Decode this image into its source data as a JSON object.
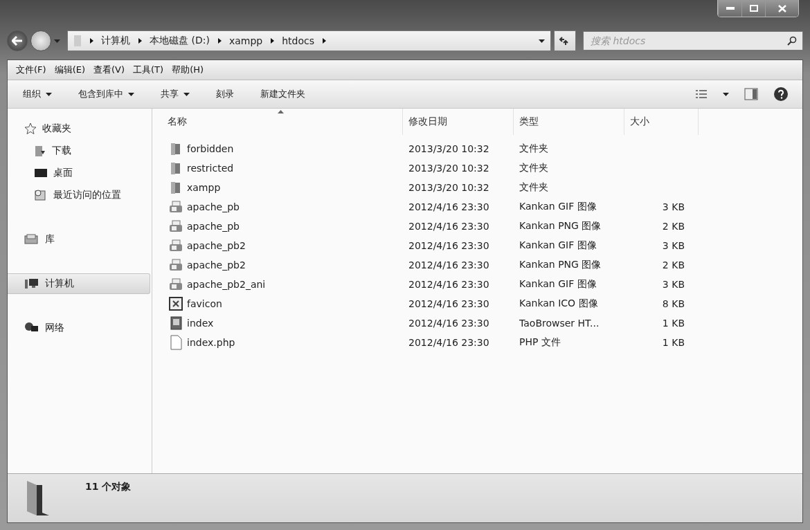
{
  "window_controls": [
    {
      "kind": "minimize"
    },
    {
      "kind": "maximize"
    },
    {
      "kind": "close"
    }
  ],
  "address_bar": {
    "segments": [
      "计算机",
      "本地磁盘 (D:)",
      "xampp",
      "htdocs"
    ]
  },
  "search": {
    "placeholder": "搜索 htdocs"
  },
  "menu_bar": [
    "文件(F)",
    "编辑(E)",
    "查看(V)",
    "工具(T)",
    "帮助(H)"
  ],
  "command_bar": [
    {
      "label": "组织",
      "has_menu": true
    },
    {
      "label": "包含到库中",
      "has_menu": true
    },
    {
      "label": "共享",
      "has_menu": true
    },
    {
      "label": "刻录",
      "has_menu": false
    },
    {
      "label": "新建文件夹",
      "has_menu": false
    }
  ],
  "nav_pane": [
    {
      "label": "收藏夹",
      "kind": "favorites",
      "selected": false,
      "children": [
        {
          "label": "下载",
          "kind": "downloads",
          "selected": false
        },
        {
          "label": "桌面",
          "kind": "desktop",
          "selected": false
        },
        {
          "label": "最近访问的位置",
          "kind": "recent",
          "selected": false
        }
      ]
    },
    {
      "label": "库",
      "kind": "libraries",
      "selected": false
    },
    {
      "label": "计算机",
      "kind": "computer",
      "selected": true
    },
    {
      "label": "网络",
      "kind": "network",
      "selected": false
    }
  ],
  "columns": [
    {
      "label": "名称",
      "sorted": true
    },
    {
      "label": "修改日期",
      "sorted": false
    },
    {
      "label": "类型",
      "sorted": false
    },
    {
      "label": "大小",
      "sorted": false
    }
  ],
  "files": [
    {
      "name": "forbidden",
      "kind": "folder",
      "modified": "2013/3/20 10:32",
      "type": "文件夹"
    },
    {
      "name": "restricted",
      "kind": "folder",
      "modified": "2013/3/20 10:32",
      "type": "文件夹"
    },
    {
      "name": "xampp",
      "kind": "folder",
      "modified": "2013/3/20 10:32",
      "type": "文件夹"
    },
    {
      "name": "apache_pb",
      "kind": "image",
      "modified": "2012/4/16 23:30",
      "type": "Kankan GIF 图像",
      "size": "3 KB"
    },
    {
      "name": "apache_pb",
      "kind": "image",
      "modified": "2012/4/16 23:30",
      "type": "Kankan PNG 图像",
      "size": "2 KB"
    },
    {
      "name": "apache_pb2",
      "kind": "image",
      "modified": "2012/4/16 23:30",
      "type": "Kankan GIF 图像",
      "size": "3 KB"
    },
    {
      "name": "apache_pb2",
      "kind": "image",
      "modified": "2012/4/16 23:30",
      "type": "Kankan PNG 图像",
      "size": "2 KB"
    },
    {
      "name": "apache_pb2_ani",
      "kind": "image",
      "modified": "2012/4/16 23:30",
      "type": "Kankan GIF 图像",
      "size": "3 KB"
    },
    {
      "name": "favicon",
      "kind": "icon",
      "modified": "2012/4/16 23:30",
      "type": "Kankan ICO 图像",
      "size": "8 KB"
    },
    {
      "name": "index",
      "kind": "html",
      "modified": "2012/4/16 23:30",
      "type": "TaoBrowser HT...",
      "size": "1 KB"
    },
    {
      "name": "index.php",
      "kind": "document",
      "modified": "2012/4/16 23:30",
      "type": "PHP 文件",
      "size": "1 KB"
    }
  ],
  "status_bar": {
    "count": "11 个对象"
  }
}
